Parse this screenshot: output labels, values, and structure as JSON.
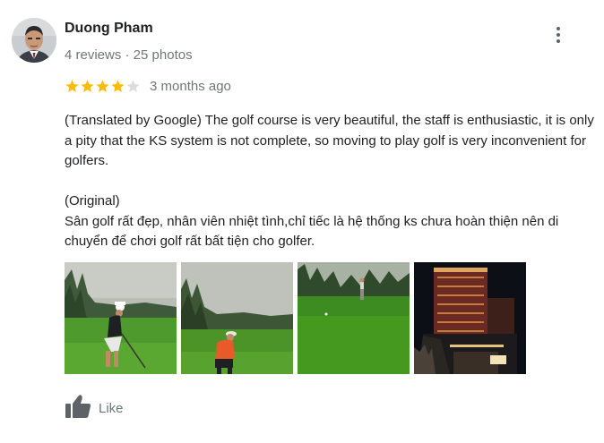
{
  "author": {
    "name": "Duong Pham",
    "meta": "4 reviews · 25 photos"
  },
  "rating": {
    "value": 4,
    "max": 5,
    "filled_color": "#fbbc04",
    "empty_color": "#dadce0"
  },
  "time": "3 months ago",
  "review": {
    "translated": "(Translated by Google) The golf course is very beautiful, the staff is enthusiastic, it is only a pity that the KS system is not complete, so moving to play golf is very inconvenient for golfers.",
    "original_label": "(Original)",
    "original": "Sân golf rất đẹp, nhân viên nhiệt tình,chỉ  tiếc là hệ thống ks chưa hoàn thiện nên di chuyển để chơi golf rất bất tiện cho golfer."
  },
  "photos": [
    {
      "icon": "golfer-swing-photo"
    },
    {
      "icon": "golfer-orange-shirt-photo"
    },
    {
      "icon": "golf-course-green-photo"
    },
    {
      "icon": "hotel-night-photo"
    }
  ],
  "actions": {
    "like_label": "Like"
  },
  "icons": {
    "more": "more-vert-icon",
    "like": "thumb-up-icon"
  }
}
